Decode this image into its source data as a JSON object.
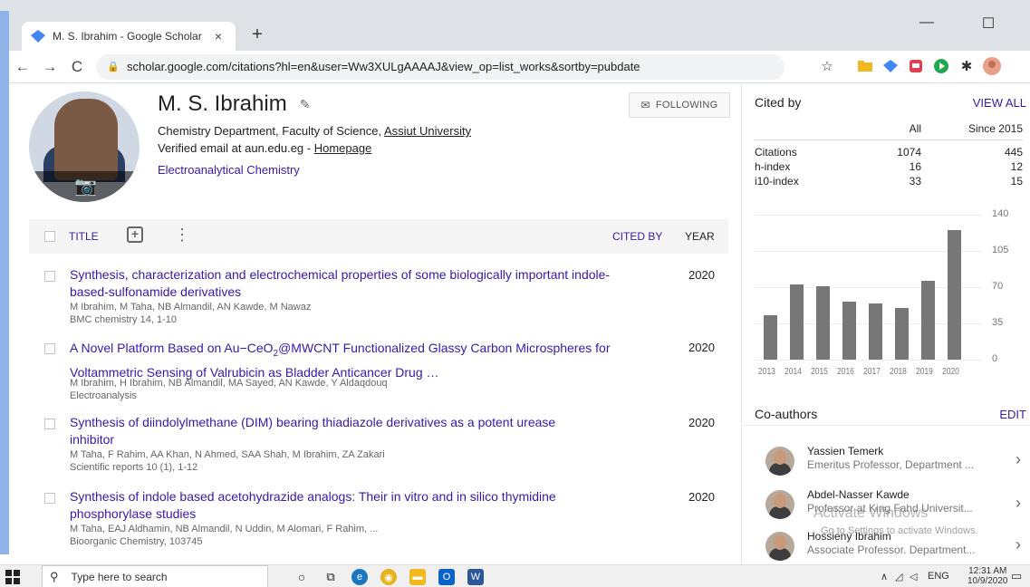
{
  "browser": {
    "tab_title": "M. S. Ibrahim - Google Scholar",
    "tab_close": "×",
    "new_tab": "+",
    "minimize": "—",
    "maximize": "☐",
    "url": "scholar.google.com/citations?hl=en&user=Ww3XULgAAAAJ&view_op=list_works&sortby=pubdate",
    "back": "←",
    "forward": "→",
    "reload": "C"
  },
  "profile": {
    "name": "M. S. Ibrahim",
    "affiliation_prefix": "Chemistry Department, Faculty of Science, ",
    "affiliation_link": "Assiut University",
    "email_text": "Verified email at aun.edu.eg - ",
    "homepage": "Homepage",
    "interest": "Electroanalytical Chemistry",
    "follow_label": "FOLLOWING"
  },
  "table": {
    "col_title": "TITLE",
    "col_cited": "CITED BY",
    "col_year": "YEAR",
    "rows": [
      {
        "title": "Synthesis, characterization and electrochemical properties of some biologically important indole-based-sulfonamide derivatives",
        "authors": "M Ibrahim, M Taha, NB Almandil, AN Kawde, M Nawaz",
        "venue": "BMC chemistry 14, 1-10",
        "year": "2020"
      },
      {
        "title_a": "A Novel Platform Based on Au−CeO",
        "title_sub": "2",
        "title_b": "@MWCNT Functionalized Glassy Carbon Microspheres for Voltammetric Sensing of Valrubicin as Bladder Anticancer Drug …",
        "authors": "M Ibrahim, H Ibrahim, NB Almandil, MA Sayed, AN Kawde, Y Aldaqdouq",
        "venue": "Electroanalysis",
        "year": "2020"
      },
      {
        "title": "Synthesis of diindolylmethane (DIM) bearing thiadiazole derivatives as a potent urease inhibitor",
        "authors": "M Taha, F Rahim, AA Khan, N Ahmed, SAA Shah, M Ibrahim, ZA Zakari",
        "venue": "Scientific reports 10 (1), 1-12",
        "year": "2020"
      },
      {
        "title": "Synthesis of indole based acetohydrazide analogs: Their in vitro and in silico thymidine phosphorylase studies",
        "authors": "M Taha, EAJ Aldhamin, NB Almandil, N Uddin, M Alomari, F Rahim, ...",
        "venue": "Bioorganic Chemistry, 103745",
        "year": "2020"
      }
    ]
  },
  "cited_by": {
    "header": "Cited by",
    "view_all": "VIEW ALL",
    "col_all": "All",
    "col_since": "Since 2015",
    "rows": [
      {
        "label": "Citations",
        "all": "1074",
        "since": "445"
      },
      {
        "label": "h-index",
        "all": "16",
        "since": "12"
      },
      {
        "label": "i10-index",
        "all": "33",
        "since": "15"
      }
    ]
  },
  "chart_data": {
    "type": "bar",
    "categories": [
      "2013",
      "2014",
      "2015",
      "2016",
      "2017",
      "2018",
      "2019",
      "2020"
    ],
    "values": [
      43,
      73,
      71,
      56,
      54,
      50,
      76,
      125
    ],
    "yticks": [
      "140",
      "105",
      "70",
      "35",
      "0"
    ],
    "ylim": [
      0,
      140
    ]
  },
  "coauthors": {
    "header": "Co-authors",
    "edit": "EDIT",
    "list": [
      {
        "name": "Yassien Temerk",
        "affil": "Emeritus Professor, Department ..."
      },
      {
        "name": "Abdel-Nasser Kawde",
        "affil": "Professor at King Fahd Universit..."
      },
      {
        "name": "Hossieny Ibrahim",
        "affil": "Associate Professor. Department..."
      }
    ]
  },
  "watermark": {
    "line1": "Activate Windows",
    "line2": "Go to Settings to activate Windows."
  },
  "taskbar": {
    "search_placeholder": "Type here to search",
    "lang": "ENG",
    "time": "12:31 AM",
    "date": "10/9/2020"
  }
}
